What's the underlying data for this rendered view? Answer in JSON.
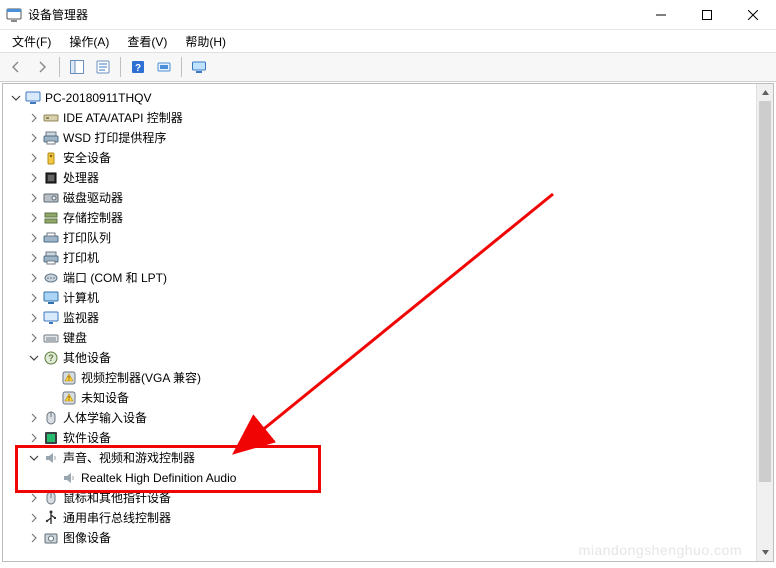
{
  "window": {
    "title": "设备管理器"
  },
  "menu": {
    "file": "文件(F)",
    "action": "操作(A)",
    "view": "查看(V)",
    "help": "帮助(H)"
  },
  "tree": {
    "root": "PC-20180911THQV",
    "nodes": [
      {
        "icon": "ide",
        "label": "IDE ATA/ATAPI 控制器"
      },
      {
        "icon": "printer",
        "label": "WSD 打印提供程序"
      },
      {
        "icon": "security",
        "label": "安全设备"
      },
      {
        "icon": "cpu",
        "label": "处理器"
      },
      {
        "icon": "disk",
        "label": "磁盘驱动器"
      },
      {
        "icon": "storage",
        "label": "存储控制器"
      },
      {
        "icon": "queue",
        "label": "打印队列"
      },
      {
        "icon": "printer",
        "label": "打印机"
      },
      {
        "icon": "port",
        "label": "端口 (COM 和 LPT)"
      },
      {
        "icon": "computer",
        "label": "计算机"
      },
      {
        "icon": "monitor",
        "label": "监视器"
      },
      {
        "icon": "keyboard",
        "label": "键盘"
      }
    ],
    "other_devices": {
      "label": "其他设备",
      "children": [
        {
          "icon": "warn-dev",
          "label": "视频控制器(VGA 兼容)"
        },
        {
          "icon": "warn-dev",
          "label": "未知设备"
        }
      ]
    },
    "after_other": [
      {
        "icon": "hid",
        "label": "人体学输入设备"
      },
      {
        "icon": "software",
        "label": "软件设备"
      }
    ],
    "sound": {
      "label": "声音、视频和游戏控制器",
      "child": "Realtek High Definition Audio"
    },
    "after_sound": [
      {
        "icon": "mouse",
        "label": "鼠标和其他指针设备"
      },
      {
        "icon": "usb",
        "label": "通用串行总线控制器"
      },
      {
        "icon": "imaging",
        "label": "图像设备"
      }
    ]
  },
  "watermark": "miandongshenghuo.com"
}
